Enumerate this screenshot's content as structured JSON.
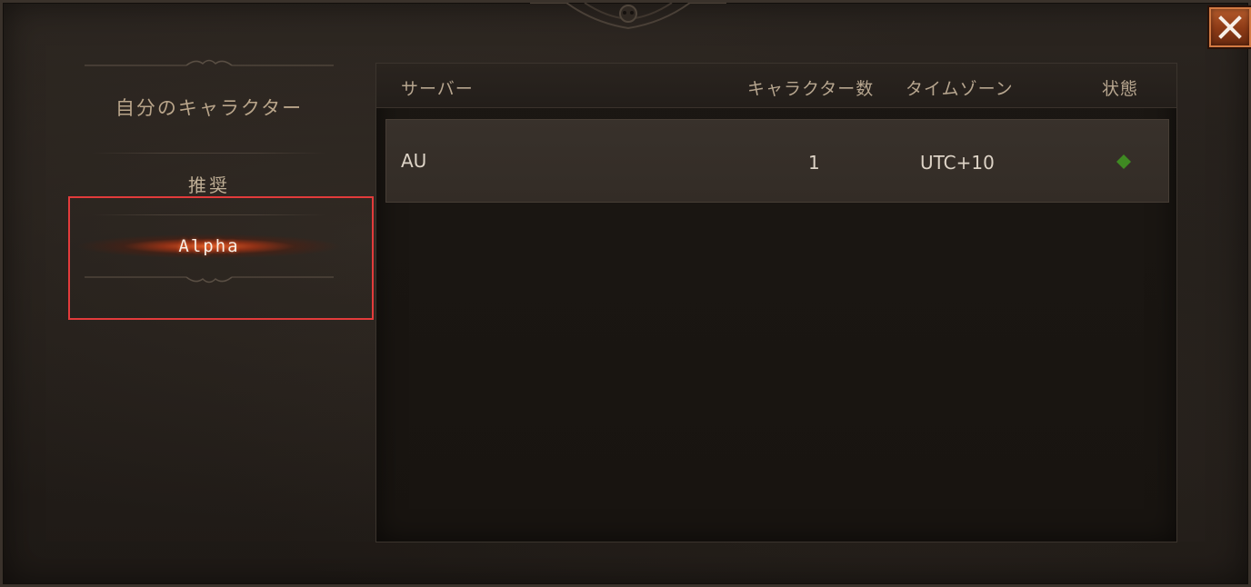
{
  "window": {
    "close_icon": "close-icon",
    "accent_color": "#b45a2b"
  },
  "sidebar": {
    "section_title": "自分のキャラクター",
    "items": [
      {
        "label": "推奨",
        "selected": false
      },
      {
        "label": "Alpha",
        "selected": true
      }
    ]
  },
  "table": {
    "headers": {
      "server": "サーバー",
      "character_count": "キャラクター数",
      "timezone": "タイムゾーン",
      "status": "状態"
    },
    "rows": [
      {
        "server": "AU",
        "character_count": "1",
        "timezone": "UTC+10",
        "status_icon": "green-diamond-icon",
        "status_color": "#3f8a22"
      }
    ]
  }
}
